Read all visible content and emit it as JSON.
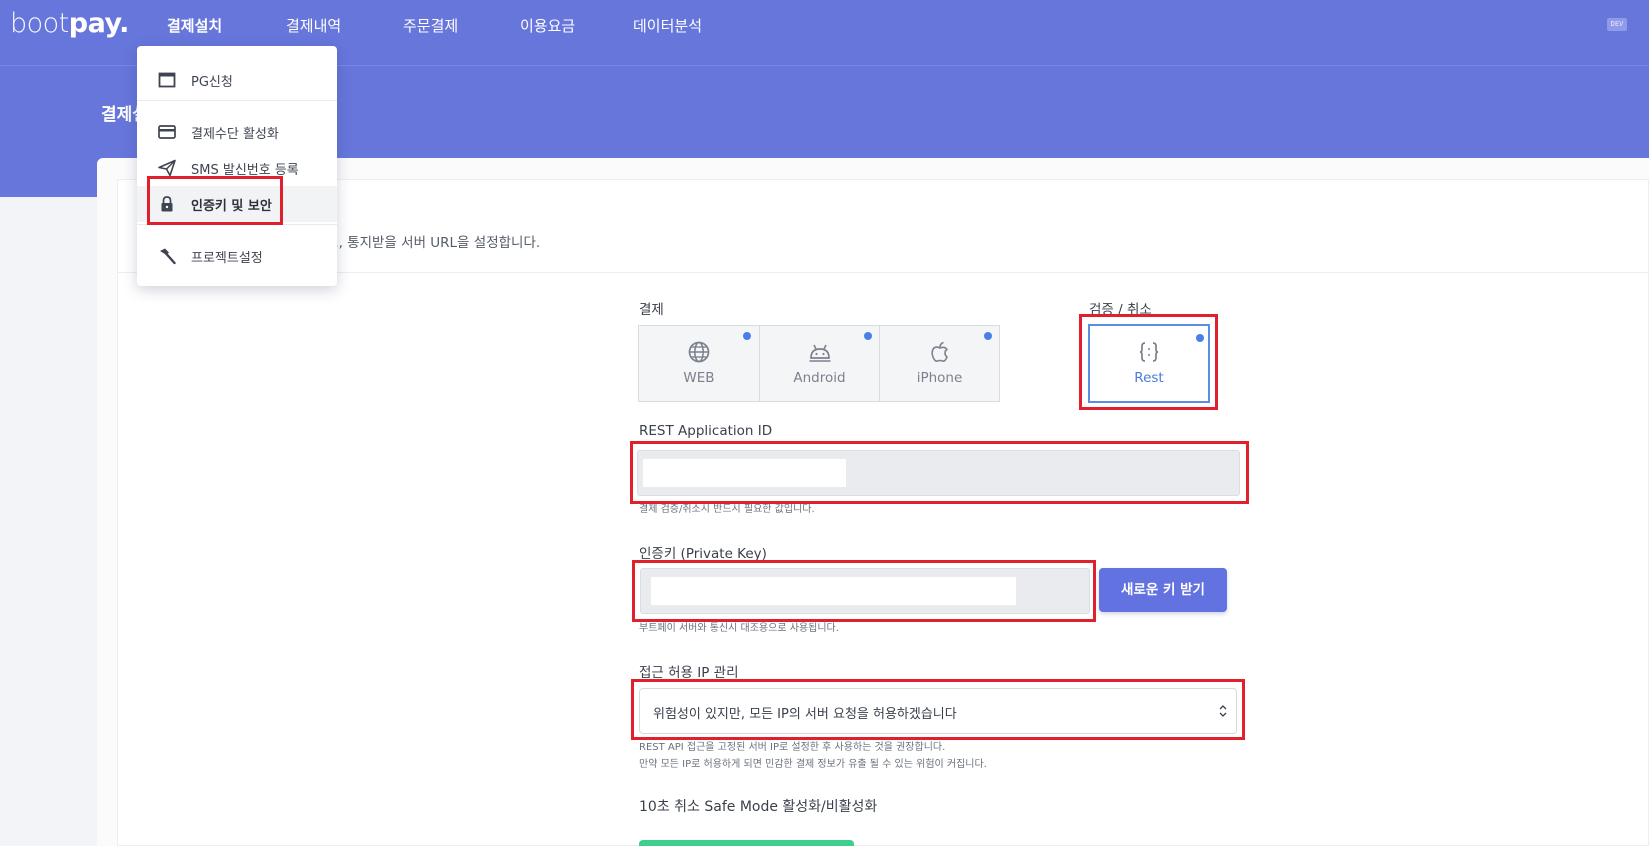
{
  "header": {
    "logo_thin": "boot",
    "logo_bold": "pay.",
    "nav": [
      "결제설치",
      "결제내역",
      "주문결제",
      "이용요금",
      "데이터분석"
    ],
    "active_index": 0,
    "dev_badge": "DEV"
  },
  "page": {
    "title": "결제설치",
    "description": "1, 통지받을 서버 URL을 설정합니다."
  },
  "dropdown": {
    "items": [
      {
        "label": "PG신청",
        "icon": "window-icon"
      },
      {
        "label": "결제수단 활성화",
        "icon": "credit-card-icon"
      },
      {
        "label": "SMS 발신번호 등록",
        "icon": "send-icon"
      },
      {
        "label": "인증키 및 보안",
        "icon": "lock-icon"
      },
      {
        "label": "프로젝트설정",
        "icon": "hammer-icon"
      }
    ],
    "highlighted_index": 3
  },
  "platforms": {
    "payment_label": "결제",
    "verify_label": "검증 / 취소",
    "items": [
      "WEB",
      "Android",
      "iPhone"
    ],
    "rest_label": "Rest"
  },
  "fields": {
    "rest_app_id_label": "REST Application ID",
    "rest_app_id_help": "결제 검증/취소시 반드시 필요한 값입니다.",
    "private_key_label": "인증키 (Private Key)",
    "private_key_help": "부트페이 서버와 통신시 대조용으로 사용됩니다.",
    "new_key_button": "새로운 키 받기",
    "ip_label": "접근 허용 IP 관리",
    "ip_select_value": "위험성이 있지만, 모든 IP의 서버 요청을 허용하겠습니다",
    "ip_help_1": "REST API 접근을 고정된 서버 IP로 설정한 후 사용하는 것을 권장합니다.",
    "ip_help_2": "만약 모든 IP로 허용하게 되면 민감한 결제 정보가 유출 될 수 있는 위험이 커집니다.",
    "safe_mode_title": "10초 취소 Safe Mode 활성화/비활성화"
  },
  "colors": {
    "brand": "#6776db",
    "primary_button": "#6272e0",
    "highlight_red": "#e0212d",
    "dot_blue": "#4a7ee8",
    "success_green": "#3ecf8e"
  }
}
